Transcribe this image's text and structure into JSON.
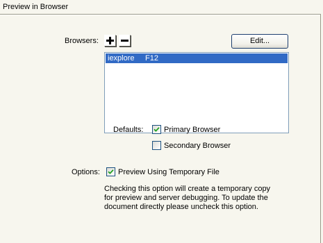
{
  "panel": {
    "title": "Preview in Browser"
  },
  "browsers": {
    "label": "Browsers:",
    "add_icon": "plus-icon",
    "remove_icon": "minus-icon",
    "edit_label": "Edit...",
    "items": [
      {
        "name": "iexplore",
        "key": "F12",
        "selected": true
      }
    ]
  },
  "defaults": {
    "label": "Defaults:",
    "primary_label": "Primary Browser",
    "primary_checked": true,
    "secondary_label": "Secondary Browser",
    "secondary_checked": false
  },
  "options": {
    "label": "Options:",
    "temp_file_label": "Preview Using Temporary File",
    "temp_file_checked": true,
    "description_lines": [
      "Checking this option will create a temporary copy",
      "for preview and server debugging. To update the",
      "document directly please uncheck this option."
    ]
  },
  "colors": {
    "background": "#f7f6ee",
    "selection": "#316ac5",
    "check_mark": "#21a121"
  }
}
